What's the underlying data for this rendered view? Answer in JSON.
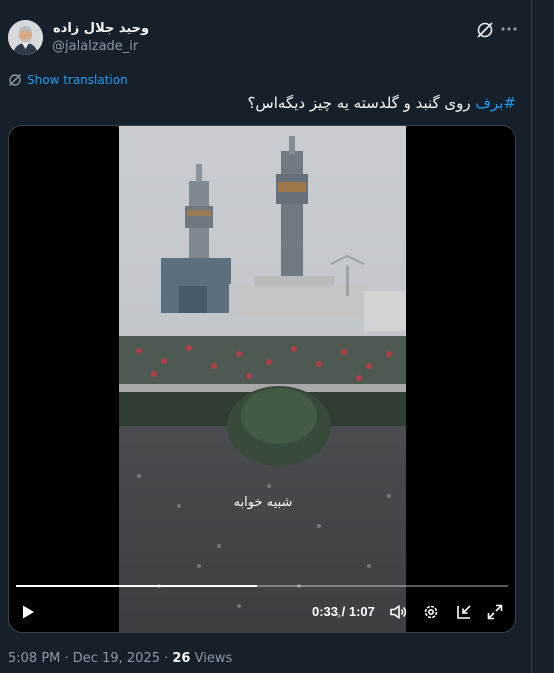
{
  "author": {
    "display_name": "وحید جلال زاده",
    "handle": "@jalalzade_ir"
  },
  "actions": {
    "grok_icon": "grok-icon",
    "more_icon": "more-options-icon"
  },
  "translation": {
    "label": "Show translation"
  },
  "tweet": {
    "hashtag": "#برف",
    "text": " روی گنبد و گلدسته یه چیز دیگه‌اس؟"
  },
  "video": {
    "caption": "شبیه خوابه",
    "time_current": "0:33",
    "time_separator": " / ",
    "time_total": "1:07",
    "progress": 0.49
  },
  "meta": {
    "time": "5:08 PM",
    "separator": " · ",
    "date": "Dec 19, 2025",
    "views_count": "26",
    "views_label": " Views"
  },
  "colors": {
    "background": "#15202b",
    "accent": "#1d9bf0",
    "muted_text": "#8b98a5",
    "border": "#38444d"
  }
}
